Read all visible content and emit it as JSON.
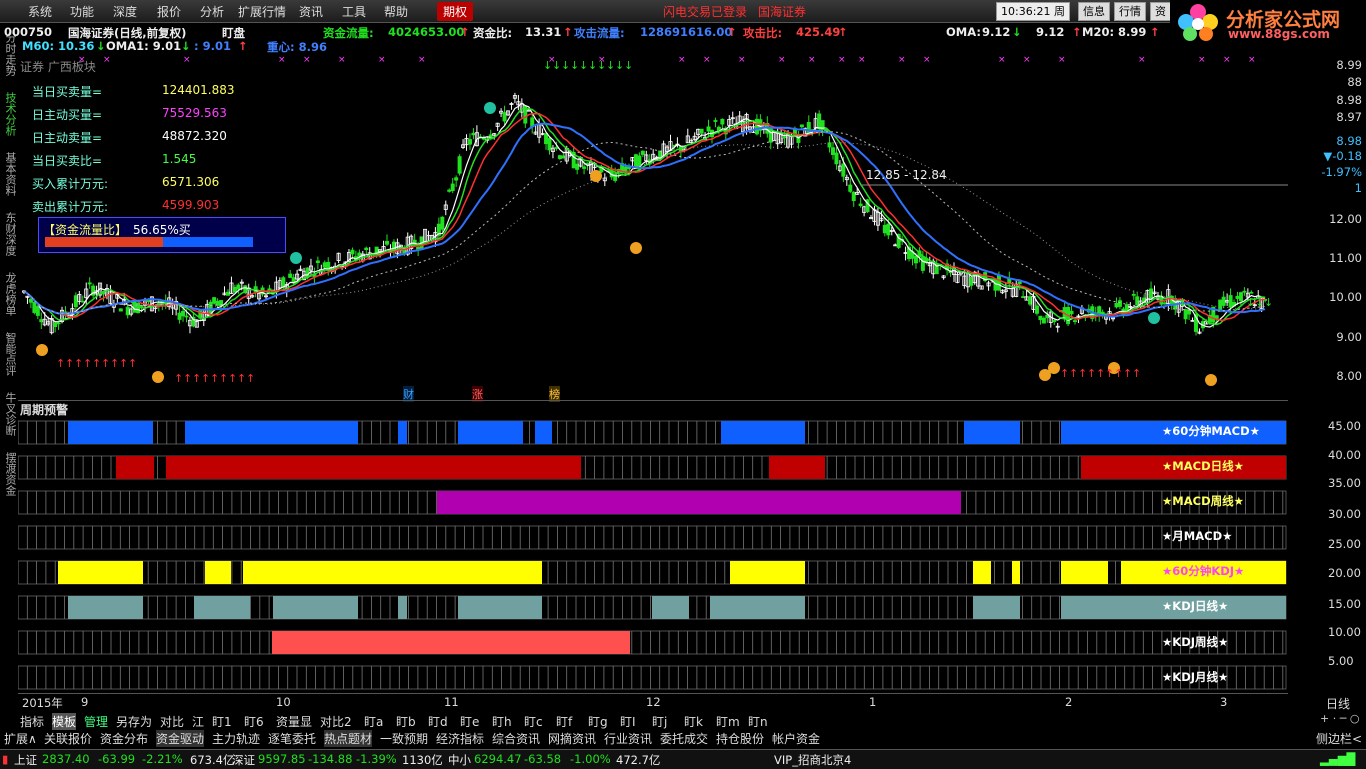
{
  "menu": {
    "items": [
      "系统",
      "功能",
      "深度",
      "报价",
      "分析",
      "扩展行情",
      "资讯",
      "工具",
      "帮助"
    ],
    "active": "期权",
    "status_login": "闪电交易已登录",
    "broker": "国海证券",
    "clock": "10:36:21",
    "weekday": "周三",
    "buttons": [
      "信息",
      "行情",
      "资"
    ]
  },
  "logo": {
    "title": "分析家公式网",
    "url": "www.88gs.com"
  },
  "colors": {
    "up": "#ff3030",
    "down": "#20e020",
    "blue_bar": "#1060ff",
    "red_bar": "#c00000",
    "purple_bar": "#b000b0",
    "yellow_bar": "#ffff00",
    "gray_bar": "#70a0a0",
    "salmon_bar": "#ff5050"
  },
  "left_tabs": [
    "分时走势",
    "技术分析",
    "基本资料",
    "东财深度",
    "龙虎榜单",
    "智能点评",
    "牛叉诊断",
    "摆渡资金"
  ],
  "header": {
    "code": "000750",
    "name": "国海证券(日线,前复权)",
    "mode": "盯盘",
    "fund_flow_label": "资金流量:",
    "fund_flow_value": "4024653.00",
    "fund_ratio_label": "资金比:",
    "fund_ratio_value": "13.31",
    "attack_flow_label": "攻击流量:",
    "attack_flow_value": "128691616.00",
    "attack_ratio_label": "攻击比:",
    "attack_ratio_value": "425.49",
    "oma_label": "OMA:",
    "oma_value": "9.12",
    "oma2_value": "9.12",
    "m20_label": "M20:",
    "m20_value": "8.99"
  },
  "header2": {
    "m60": "M60: 10.36",
    "oma1": "OMA1: 9.01",
    "v3": ": 9.01",
    "center": "重心: 8.96"
  },
  "panel": {
    "sector": "证券 广西板块",
    "rows": [
      {
        "label": "当日买卖量=",
        "value": "124401.883",
        "color": "#ffff60"
      },
      {
        "label": "日主动买量=",
        "value": "75529.563",
        "color": "#ff40ff"
      },
      {
        "label": "日主动卖量=",
        "value": "48872.320",
        "color": "#ffffff"
      },
      {
        "label": "当日买卖比=",
        "value": "1.545",
        "color": "#40ff40"
      },
      {
        "label": "买入累计万元:",
        "value": "6571.306",
        "color": "#ffff60"
      },
      {
        "label": "卖出累计万元:",
        "value": "4599.903",
        "color": "#ff3030"
      }
    ],
    "ratio_label": "【资金流量比】",
    "ratio_value": "56.65%买",
    "ratio_pct": 0.5665
  },
  "chart": {
    "price_labels": [
      "8.99",
      "88",
      "8.98",
      "8.97",
      "8.98",
      "-0.18",
      "-1.97%",
      "1",
      "12.00",
      "11.00",
      "10.00",
      "9.00",
      "8.00"
    ],
    "annotation": "12.85 - 12.84",
    "event_tags": [
      "财",
      "涨",
      "榜"
    ]
  },
  "warning": {
    "title": "周期预警",
    "rows": [
      {
        "label": "★60分钟MACD★",
        "color": "#1060ff",
        "text_color": "#ffffff"
      },
      {
        "label": "★MACD日线★",
        "color": "#c00000",
        "text_color": "#ffff60"
      },
      {
        "label": "★MACD周线★",
        "color": "#b000b0",
        "text_color": "#ffff60"
      },
      {
        "label": "★月MACD★",
        "color": "#1060ff",
        "text_color": "#ffffff"
      },
      {
        "label": "★60分钟KDJ★",
        "color": "#ffff00",
        "text_color": "#ff40ff"
      },
      {
        "label": "★KDJ日线★",
        "color": "#70a0a0",
        "text_color": "#ffffff"
      },
      {
        "label": "★KDJ周线★",
        "color": "#ff5050",
        "text_color": "#ffffff"
      },
      {
        "label": "★KDJ月线★",
        "color": "#70a0a0",
        "text_color": "#ffffff"
      }
    ],
    "ticks": [
      "45.00",
      "40.00",
      "35.00",
      "30.00",
      "25.00",
      "20.00",
      "15.00",
      "10.00",
      "5.00"
    ]
  },
  "time_axis": {
    "year": "2015年",
    "months": [
      "9",
      "10",
      "11",
      "12",
      "1",
      "2",
      "3"
    ],
    "period": "日线"
  },
  "bottom_tabs1": [
    "指标",
    "模板",
    "管理",
    "另存为",
    "对比",
    "江",
    "盯1",
    "盯6",
    "资量显",
    "对比2",
    "盯a",
    "盯b",
    "盯d",
    "盯e",
    "盯h",
    "盯c",
    "盯f",
    "盯g",
    "盯I",
    "盯j",
    "盯k",
    "盯m",
    "盯n"
  ],
  "bottom_tabs2": [
    "扩展∧",
    "关联报价",
    "资金分布",
    "资金驱动",
    "主力轨迹",
    "逐笔委托",
    "热点题材",
    "一致预期",
    "经济指标",
    "综合资讯",
    "网摘资讯",
    "行业资讯",
    "委托成交",
    "持仓股份",
    "帐户资金"
  ],
  "side_ctrl": "侧边栏<",
  "status": {
    "sh_label": "上证",
    "sh_value": "2837.40",
    "sh_change": "-63.99",
    "sh_pct": "-2.21%",
    "sh_amount": "673.4亿",
    "sz_label": "深证",
    "sz_value": "9597.85",
    "sz_change": "-134.88",
    "sz_pct": "-1.39%",
    "sz_amount": "1130亿",
    "zx_label": "中小",
    "zx_value": "6294.47",
    "zx_change": "-63.58",
    "zx_pct": "-1.00%",
    "zx_amount": "472.7亿",
    "vip": "VIP_招商北京4"
  }
}
